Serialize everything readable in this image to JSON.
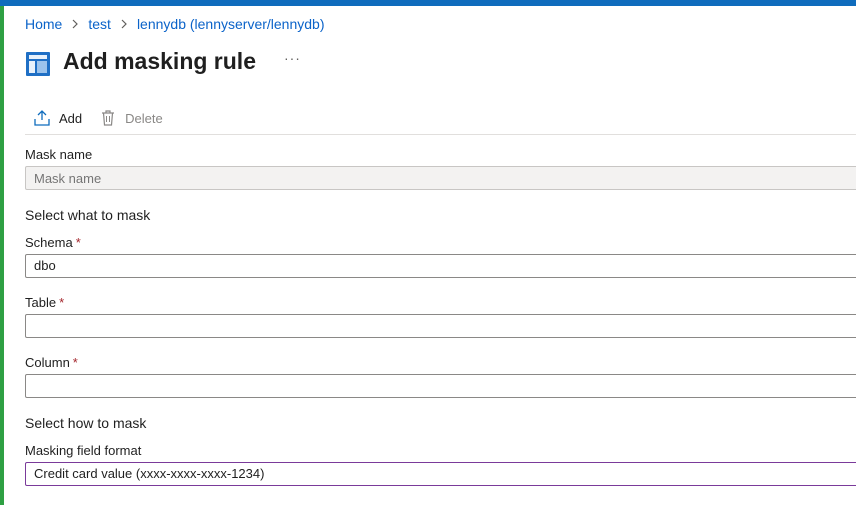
{
  "breadcrumb": {
    "items": [
      "Home",
      "test",
      "lennydb (lennyserver/lennydb)"
    ]
  },
  "page": {
    "title": "Add masking rule",
    "more": "···"
  },
  "toolbar": {
    "add_label": "Add",
    "delete_label": "Delete"
  },
  "form": {
    "mask_name": {
      "label": "Mask name",
      "placeholder": "Mask name"
    },
    "section_what": "Select what to mask",
    "schema": {
      "label": "Schema",
      "required": "*",
      "value": "dbo"
    },
    "table": {
      "label": "Table",
      "required": "*",
      "value": ""
    },
    "column": {
      "label": "Column",
      "required": "*",
      "value": ""
    },
    "section_how": "Select how to mask",
    "masking_format": {
      "label": "Masking field format",
      "value": "Credit card value (xxxx-xxxx-xxxx-1234)"
    }
  },
  "colors": {
    "accent": "#0f6cbd",
    "link": "#0b63c9",
    "required": "#a4262c",
    "left_bar": "#2ea043"
  }
}
